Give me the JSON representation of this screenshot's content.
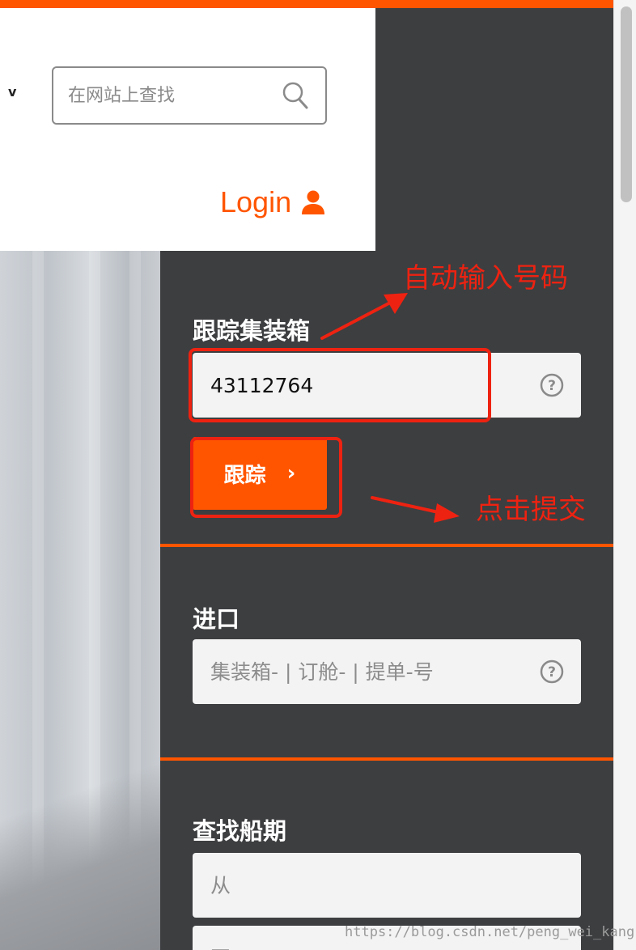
{
  "header": {
    "search": {
      "placeholder": "在网站上查找",
      "icon": "search-icon"
    },
    "chevron": "v",
    "login": {
      "label": "Login",
      "icon": "user-icon"
    },
    "accent_color": "#ff5500"
  },
  "track": {
    "title": "跟踪集装箱",
    "input_value": "43112764",
    "help_icon": "help-circle-icon",
    "button_label": "跟踪",
    "button_arrow": "›"
  },
  "import": {
    "title": "进口",
    "placeholder": "集装箱- | 订舱- | 提单-号",
    "help_icon": "help-circle-icon"
  },
  "schedule": {
    "title": "查找船期",
    "from_placeholder": "从",
    "to_placeholder": "至"
  },
  "annotations": {
    "auto_input": "自动输入号码",
    "click_submit": "点击提交",
    "color": "#ee2211"
  },
  "watermark": "https://blog.csdn.net/peng_wei_kang"
}
